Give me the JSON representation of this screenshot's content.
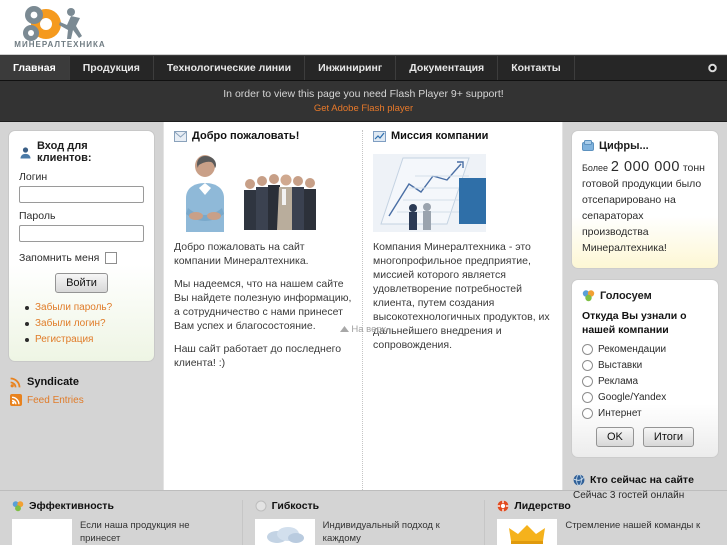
{
  "header": {
    "logo_text": "МИНЕРАЛТЕХНИКА",
    "logo_icon": "gears-and-runner-logo"
  },
  "nav": {
    "items": [
      {
        "label": "Главная",
        "active": true
      },
      {
        "label": "Продукция",
        "active": false
      },
      {
        "label": "Технологические линии",
        "active": false
      },
      {
        "label": "Инжиниринг",
        "active": false
      },
      {
        "label": "Документация",
        "active": false
      },
      {
        "label": "Контакты",
        "active": false
      }
    ],
    "corner_icon": "record-dot-icon"
  },
  "flash_notice": {
    "message": "In order to view this page you need Flash Player 9+ support!",
    "link": "Get Adobe Flash player",
    "link_color": "#e8792a"
  },
  "login": {
    "title": "Вход для клиентов:",
    "title_icon": "user-icon",
    "username_label": "Логин",
    "username_value": "",
    "username_placeholder": "",
    "password_label": "Пароль",
    "password_value": "",
    "password_placeholder": "",
    "remember_label": "Запомнить меня",
    "remember_checked": false,
    "submit_label": "Войти",
    "links": [
      "Забыли пароль?",
      "Забыли логин?",
      "Регистрация"
    ]
  },
  "syndicate": {
    "title": "Syndicate",
    "title_icon": "rss-icon",
    "entry_label": "Feed Entries",
    "entry_icon": "rss-icon"
  },
  "welcome": {
    "title": "Добро пожаловать!",
    "title_icon": "envelope-icon",
    "image_left": "businessman-photo",
    "image_right": "business-team-photo",
    "paragraphs": [
      "Добро пожаловать на сайт компании Минералтехника.",
      "Мы надеемся, что на нашем сайте Вы найдете полезную информацию, а сотрудничество с нами принесет Вам успех и благосостояние.",
      "Наш сайт работает до последнего клиента! :)"
    ]
  },
  "mission": {
    "title": "Миссия компании",
    "title_icon": "chart-icon",
    "image": "growth-chart-figurines-photo",
    "paragraphs": [
      "Компания Минералтехника - это многопрофильное предприятие, миссией которого является удовлетворение потребностей клиента, путем создания высокотехнологичных продуктов, их дальнейшего внедрения и сопровождения."
    ]
  },
  "to_top": {
    "label": "На верх",
    "icon": "triangle-up-icon"
  },
  "numbers": {
    "title": "Цифры...",
    "title_icon": "blue-square-icon",
    "prefix": "Более",
    "big_value": "2 000 000",
    "unit": "тонн",
    "rest": "готовой продукции было отсепарировано на сепараторах производства Минералтехника!"
  },
  "poll": {
    "title": "Голосуем",
    "title_icon": "clover-icon",
    "question": "Откуда Вы узнали о нашей компании",
    "options": [
      "Рекомендации",
      "Выставки",
      "Реклама",
      "Google/Yandex",
      "Интернет"
    ],
    "selected": null,
    "ok_label": "OK",
    "results_label": "Итоги"
  },
  "who_online": {
    "title": "Кто сейчас на сайте",
    "title_icon": "globe-icon",
    "text": "Сейчас 3 гостей онлайн"
  },
  "footer": {
    "columns": [
      {
        "title": "Эффективность",
        "icon": "clover-icon",
        "thumb": "product-photo",
        "text": "Если наша продукция не принесет"
      },
      {
        "title": "Гибкость",
        "icon": "grey-circle-icon",
        "thumb": "cloud-photo",
        "text": "Индивидуальный подход к каждому"
      },
      {
        "title": "Лидерство",
        "icon": "lifebuoy-icon",
        "thumb": "crown-photo",
        "text": "Стремление нашей команды к"
      }
    ]
  },
  "colors": {
    "accent_orange": "#e07b28",
    "nav_dark": "#262626",
    "flash_dark": "#333333",
    "page_grey": "#d4d4d4"
  }
}
